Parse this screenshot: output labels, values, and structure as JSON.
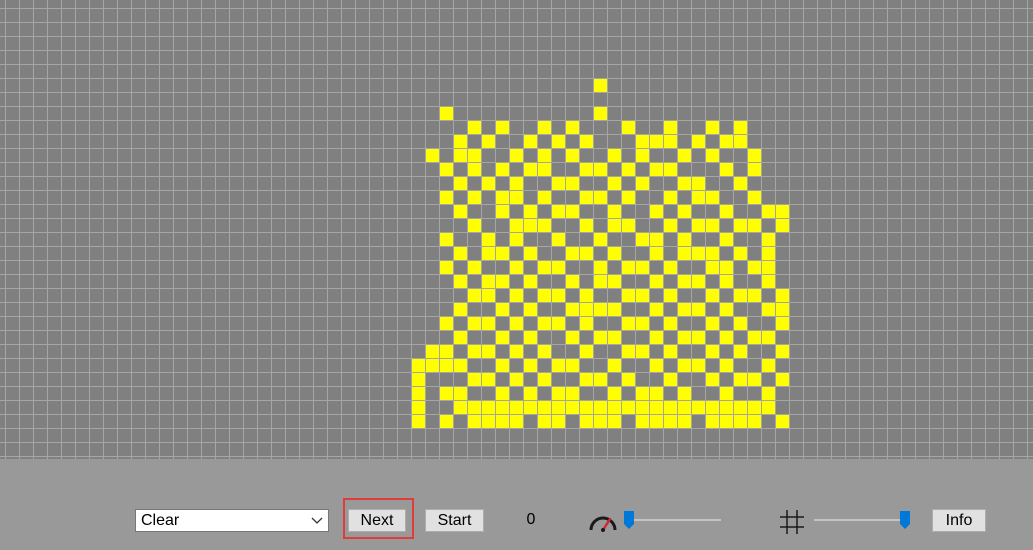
{
  "grid": {
    "cell_color": "#ffff00",
    "grid_background": "#808080",
    "grid_line_color": "#a6a6a6",
    "live_cells": [
      [
        42,
        5
      ],
      [
        31,
        7
      ],
      [
        42,
        7
      ],
      [
        33,
        8
      ],
      [
        35,
        8
      ],
      [
        38,
        8
      ],
      [
        40,
        8
      ],
      [
        44,
        8
      ],
      [
        47,
        8
      ],
      [
        50,
        8
      ],
      [
        52,
        8
      ],
      [
        32,
        9
      ],
      [
        34,
        9
      ],
      [
        37,
        9
      ],
      [
        39,
        9
      ],
      [
        41,
        9
      ],
      [
        45,
        9
      ],
      [
        46,
        9
      ],
      [
        47,
        9
      ],
      [
        49,
        9
      ],
      [
        51,
        9
      ],
      [
        52,
        9
      ],
      [
        30,
        10
      ],
      [
        32,
        10
      ],
      [
        33,
        10
      ],
      [
        36,
        10
      ],
      [
        38,
        10
      ],
      [
        40,
        10
      ],
      [
        43,
        10
      ],
      [
        45,
        10
      ],
      [
        48,
        10
      ],
      [
        50,
        10
      ],
      [
        53,
        10
      ],
      [
        31,
        11
      ],
      [
        33,
        11
      ],
      [
        35,
        11
      ],
      [
        37,
        11
      ],
      [
        38,
        11
      ],
      [
        41,
        11
      ],
      [
        42,
        11
      ],
      [
        44,
        11
      ],
      [
        46,
        11
      ],
      [
        47,
        11
      ],
      [
        51,
        11
      ],
      [
        53,
        11
      ],
      [
        32,
        12
      ],
      [
        34,
        12
      ],
      [
        36,
        12
      ],
      [
        39,
        12
      ],
      [
        40,
        12
      ],
      [
        43,
        12
      ],
      [
        45,
        12
      ],
      [
        48,
        12
      ],
      [
        49,
        12
      ],
      [
        52,
        12
      ],
      [
        31,
        13
      ],
      [
        33,
        13
      ],
      [
        35,
        13
      ],
      [
        36,
        13
      ],
      [
        38,
        13
      ],
      [
        41,
        13
      ],
      [
        42,
        13
      ],
      [
        44,
        13
      ],
      [
        47,
        13
      ],
      [
        49,
        13
      ],
      [
        50,
        13
      ],
      [
        53,
        13
      ],
      [
        32,
        14
      ],
      [
        35,
        14
      ],
      [
        37,
        14
      ],
      [
        39,
        14
      ],
      [
        40,
        14
      ],
      [
        43,
        14
      ],
      [
        46,
        14
      ],
      [
        48,
        14
      ],
      [
        51,
        14
      ],
      [
        54,
        14
      ],
      [
        55,
        14
      ],
      [
        33,
        15
      ],
      [
        36,
        15
      ],
      [
        37,
        15
      ],
      [
        38,
        15
      ],
      [
        41,
        15
      ],
      [
        43,
        15
      ],
      [
        44,
        15
      ],
      [
        47,
        15
      ],
      [
        49,
        15
      ],
      [
        50,
        15
      ],
      [
        52,
        15
      ],
      [
        53,
        15
      ],
      [
        55,
        15
      ],
      [
        31,
        16
      ],
      [
        34,
        16
      ],
      [
        36,
        16
      ],
      [
        39,
        16
      ],
      [
        42,
        16
      ],
      [
        45,
        16
      ],
      [
        46,
        16
      ],
      [
        48,
        16
      ],
      [
        51,
        16
      ],
      [
        54,
        16
      ],
      [
        32,
        17
      ],
      [
        34,
        17
      ],
      [
        35,
        17
      ],
      [
        37,
        17
      ],
      [
        40,
        17
      ],
      [
        41,
        17
      ],
      [
        43,
        17
      ],
      [
        46,
        17
      ],
      [
        48,
        17
      ],
      [
        49,
        17
      ],
      [
        50,
        17
      ],
      [
        52,
        17
      ],
      [
        54,
        17
      ],
      [
        31,
        18
      ],
      [
        33,
        18
      ],
      [
        36,
        18
      ],
      [
        38,
        18
      ],
      [
        39,
        18
      ],
      [
        42,
        18
      ],
      [
        44,
        18
      ],
      [
        45,
        18
      ],
      [
        47,
        18
      ],
      [
        50,
        18
      ],
      [
        51,
        18
      ],
      [
        53,
        18
      ],
      [
        54,
        18
      ],
      [
        32,
        19
      ],
      [
        34,
        19
      ],
      [
        35,
        19
      ],
      [
        37,
        19
      ],
      [
        40,
        19
      ],
      [
        42,
        19
      ],
      [
        43,
        19
      ],
      [
        46,
        19
      ],
      [
        48,
        19
      ],
      [
        49,
        19
      ],
      [
        51,
        19
      ],
      [
        54,
        19
      ],
      [
        33,
        20
      ],
      [
        34,
        20
      ],
      [
        36,
        20
      ],
      [
        38,
        20
      ],
      [
        39,
        20
      ],
      [
        41,
        20
      ],
      [
        44,
        20
      ],
      [
        45,
        20
      ],
      [
        47,
        20
      ],
      [
        50,
        20
      ],
      [
        52,
        20
      ],
      [
        53,
        20
      ],
      [
        55,
        20
      ],
      [
        32,
        21
      ],
      [
        35,
        21
      ],
      [
        37,
        21
      ],
      [
        40,
        21
      ],
      [
        41,
        21
      ],
      [
        42,
        21
      ],
      [
        43,
        21
      ],
      [
        46,
        21
      ],
      [
        48,
        21
      ],
      [
        49,
        21
      ],
      [
        51,
        21
      ],
      [
        54,
        21
      ],
      [
        55,
        21
      ],
      [
        31,
        22
      ],
      [
        33,
        22
      ],
      [
        34,
        22
      ],
      [
        36,
        22
      ],
      [
        38,
        22
      ],
      [
        39,
        22
      ],
      [
        41,
        22
      ],
      [
        44,
        22
      ],
      [
        45,
        22
      ],
      [
        47,
        22
      ],
      [
        50,
        22
      ],
      [
        52,
        22
      ],
      [
        55,
        22
      ],
      [
        32,
        23
      ],
      [
        35,
        23
      ],
      [
        37,
        23
      ],
      [
        40,
        23
      ],
      [
        42,
        23
      ],
      [
        43,
        23
      ],
      [
        46,
        23
      ],
      [
        48,
        23
      ],
      [
        49,
        23
      ],
      [
        51,
        23
      ],
      [
        53,
        23
      ],
      [
        54,
        23
      ],
      [
        30,
        24
      ],
      [
        31,
        24
      ],
      [
        33,
        24
      ],
      [
        34,
        24
      ],
      [
        36,
        24
      ],
      [
        38,
        24
      ],
      [
        41,
        24
      ],
      [
        44,
        24
      ],
      [
        45,
        24
      ],
      [
        47,
        24
      ],
      [
        50,
        24
      ],
      [
        52,
        24
      ],
      [
        55,
        24
      ],
      [
        29,
        25
      ],
      [
        30,
        25
      ],
      [
        31,
        25
      ],
      [
        32,
        25
      ],
      [
        35,
        25
      ],
      [
        37,
        25
      ],
      [
        39,
        25
      ],
      [
        40,
        25
      ],
      [
        43,
        25
      ],
      [
        46,
        25
      ],
      [
        48,
        25
      ],
      [
        49,
        25
      ],
      [
        51,
        25
      ],
      [
        54,
        25
      ],
      [
        29,
        26
      ],
      [
        33,
        26
      ],
      [
        34,
        26
      ],
      [
        36,
        26
      ],
      [
        38,
        26
      ],
      [
        41,
        26
      ],
      [
        42,
        26
      ],
      [
        44,
        26
      ],
      [
        47,
        26
      ],
      [
        50,
        26
      ],
      [
        52,
        26
      ],
      [
        53,
        26
      ],
      [
        55,
        26
      ],
      [
        29,
        27
      ],
      [
        31,
        27
      ],
      [
        32,
        27
      ],
      [
        35,
        27
      ],
      [
        37,
        27
      ],
      [
        39,
        27
      ],
      [
        40,
        27
      ],
      [
        43,
        27
      ],
      [
        45,
        27
      ],
      [
        46,
        27
      ],
      [
        48,
        27
      ],
      [
        51,
        27
      ],
      [
        54,
        27
      ],
      [
        29,
        28
      ],
      [
        32,
        28
      ],
      [
        33,
        28
      ],
      [
        34,
        28
      ],
      [
        35,
        28
      ],
      [
        36,
        28
      ],
      [
        37,
        28
      ],
      [
        38,
        28
      ],
      [
        39,
        28
      ],
      [
        40,
        28
      ],
      [
        41,
        28
      ],
      [
        42,
        28
      ],
      [
        43,
        28
      ],
      [
        44,
        28
      ],
      [
        45,
        28
      ],
      [
        46,
        28
      ],
      [
        47,
        28
      ],
      [
        48,
        28
      ],
      [
        49,
        28
      ],
      [
        50,
        28
      ],
      [
        51,
        28
      ],
      [
        52,
        28
      ],
      [
        53,
        28
      ],
      [
        54,
        28
      ],
      [
        29,
        29
      ],
      [
        31,
        29
      ],
      [
        33,
        29
      ],
      [
        34,
        29
      ],
      [
        35,
        29
      ],
      [
        36,
        29
      ],
      [
        38,
        29
      ],
      [
        39,
        29
      ],
      [
        41,
        29
      ],
      [
        42,
        29
      ],
      [
        43,
        29
      ],
      [
        45,
        29
      ],
      [
        46,
        29
      ],
      [
        47,
        29
      ],
      [
        48,
        29
      ],
      [
        50,
        29
      ],
      [
        51,
        29
      ],
      [
        52,
        29
      ],
      [
        53,
        29
      ],
      [
        55,
        29
      ]
    ]
  },
  "controls": {
    "pattern_select": {
      "value": "Clear"
    },
    "next_label": "Next",
    "start_label": "Start",
    "generation": "0",
    "speed_slider": {
      "value": 0.0,
      "icon": "speedometer-icon"
    },
    "grid_size_slider": {
      "value": 1.0,
      "icon": "grid-icon"
    },
    "info_label": "Info",
    "accent_color": "#0078d7",
    "focus_color": "#e03c3c"
  }
}
